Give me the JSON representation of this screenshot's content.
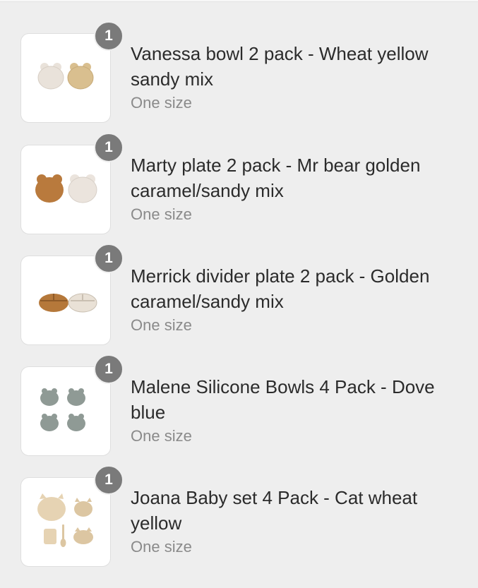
{
  "cart": {
    "items": [
      {
        "quantity": "1",
        "title": "Vanessa bowl 2 pack - Wheat yellow sandy mix",
        "variant": "One size",
        "thumbnail_colors": [
          "#e9e2da",
          "#d9bf8f"
        ]
      },
      {
        "quantity": "1",
        "title": "Marty plate 2 pack - Mr bear golden caramel/sandy mix",
        "variant": "One size",
        "thumbnail_colors": [
          "#b97a3d",
          "#ebe4dd"
        ]
      },
      {
        "quantity": "1",
        "title": "Merrick divider plate 2 pack - Golden caramel/sandy mix",
        "variant": "One size",
        "thumbnail_colors": [
          "#b5783a",
          "#e9e1d6"
        ]
      },
      {
        "quantity": "1",
        "title": "Malene Silicone Bowls 4 Pack - Dove blue",
        "variant": "One size",
        "thumbnail_colors": [
          "#8f9a95",
          "#a5aea9"
        ]
      },
      {
        "quantity": "1",
        "title": "Joana Baby set 4 Pack - Cat wheat yellow",
        "variant": "One size",
        "thumbnail_colors": [
          "#e6d3b3",
          "#dcc6a2"
        ]
      }
    ]
  }
}
